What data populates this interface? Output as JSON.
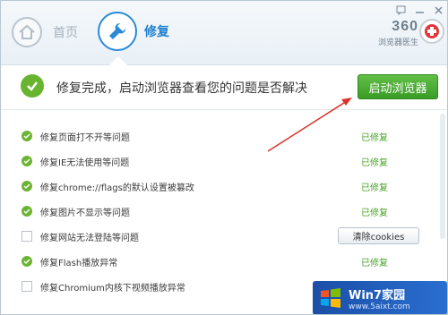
{
  "header": {
    "home_label": "首页",
    "repair_label": "修复",
    "brand_name": "360",
    "brand_sub": "浏览器医生",
    "window_controls": [
      "feedback-icon",
      "minimize-icon",
      "close-icon"
    ]
  },
  "banner": {
    "message": "修复完成，启动浏览器查看您的问题是否解决",
    "launch_button": "启动浏览器"
  },
  "items": [
    {
      "label": "修复页面打不开等问题",
      "checked": true,
      "status": "已修复"
    },
    {
      "label": "修复IE无法使用等问题",
      "checked": true,
      "status": "已修复"
    },
    {
      "label": "修复chrome://flags的默认设置被篡改",
      "checked": true,
      "status": "已修复"
    },
    {
      "label": "修复图片不显示等问题",
      "checked": true,
      "status": "已修复"
    },
    {
      "label": "修复网站无法登陆等问题",
      "checked": false,
      "button": "清除cookies"
    },
    {
      "label": "修复Flash播放异常",
      "checked": true,
      "status": "已修复"
    },
    {
      "label": "修复Chromium内核下视频播放异常",
      "checked": false,
      "status": ""
    }
  ],
  "watermark": {
    "title": "Win7家园",
    "url": "www.5aixt.com"
  },
  "colors": {
    "accent_blue": "#2a8ad8",
    "success_green": "#49a228",
    "button_green": "#3a9b25",
    "arrow_red": "#d9342b"
  }
}
